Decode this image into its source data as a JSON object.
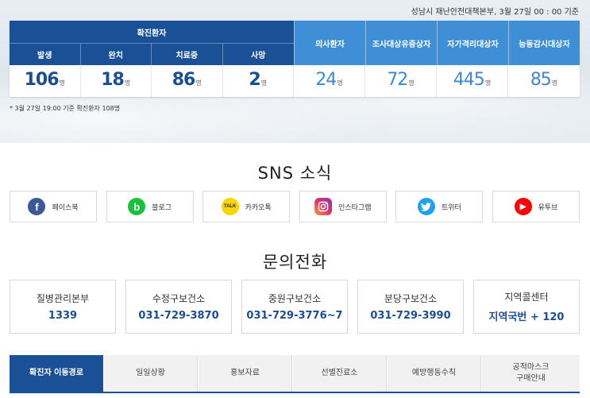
{
  "header": {
    "updated": "성남시 재난안전대책본부, 3월 27일 00 : 00 기준"
  },
  "stats": {
    "confirmed_group_label": "확진환자",
    "confirmed": [
      {
        "label": "발생",
        "value": "106",
        "unit": "명"
      },
      {
        "label": "완치",
        "value": "18",
        "unit": "명"
      },
      {
        "label": "치료중",
        "value": "86",
        "unit": "명"
      },
      {
        "label": "사망",
        "value": "2",
        "unit": "명"
      }
    ],
    "others": [
      {
        "label": "의사환자",
        "value": "24",
        "unit": "명"
      },
      {
        "label": "조사대상유증상자",
        "value": "72",
        "unit": "명"
      },
      {
        "label": "자가격리대상자",
        "value": "445",
        "unit": "명"
      },
      {
        "label": "능동감시대상자",
        "value": "85",
        "unit": "명"
      }
    ],
    "note": "* 3월 27일 19:00 기준 확진환자 108명"
  },
  "sns": {
    "title": "SNS 소식",
    "items": [
      {
        "label": "페이스북",
        "icon": "facebook-icon",
        "color": "#3b5998",
        "glyph": "f"
      },
      {
        "label": "블로그",
        "icon": "blog-icon",
        "color": "#19c23a",
        "glyph": "b"
      },
      {
        "label": "카카오톡",
        "icon": "kakaotalk-icon",
        "color": "#f7d600",
        "glyph": "TALK"
      },
      {
        "label": "인스타그램",
        "icon": "instagram-icon",
        "color": "#c13584",
        "glyph": "◎"
      },
      {
        "label": "트위터",
        "icon": "twitter-icon",
        "color": "#1da1f2",
        "glyph": "✦"
      },
      {
        "label": "유투브",
        "icon": "youtube-icon",
        "color": "#ff0000",
        "glyph": "▶"
      }
    ]
  },
  "contact": {
    "title": "문의전화",
    "items": [
      {
        "name": "질병관리본부",
        "number": "1339"
      },
      {
        "name": "수정구보건소",
        "number": "031-729-3870"
      },
      {
        "name": "중원구보건소",
        "number": "031-729-3776~7"
      },
      {
        "name": "분당구보건소",
        "number": "031-729-3990"
      },
      {
        "name": "지역콜센터",
        "number": "지역국번 + 120"
      }
    ]
  },
  "tabs": {
    "items": [
      {
        "label": "확진자 이동경로",
        "active": true
      },
      {
        "label": "일일상황",
        "active": false
      },
      {
        "label": "홍보자료",
        "active": false
      },
      {
        "label": "선별진료소",
        "active": false
      },
      {
        "label": "예방행동수칙",
        "active": false
      },
      {
        "label": "공적마스크\n구매안내",
        "active": false
      }
    ]
  },
  "colors": {
    "primary": "#1a5196",
    "secondary": "#3f8fd7",
    "number": "#1a4e92"
  }
}
